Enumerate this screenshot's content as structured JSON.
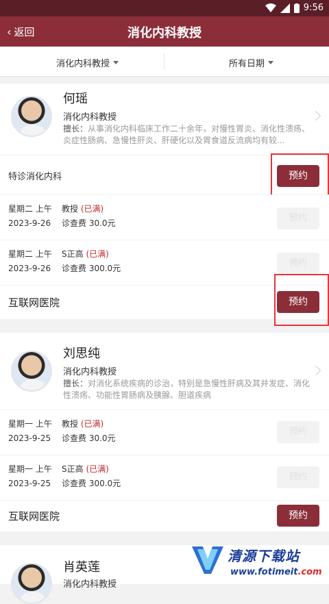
{
  "status_bar": {
    "time": "9:56",
    "icons": [
      "wifi-icon",
      "signal-icon",
      "battery-icon"
    ]
  },
  "header": {
    "back_label": "返回",
    "title": "消化内科教授"
  },
  "filters": {
    "department": "消化内科教授",
    "date": "所有日期"
  },
  "colors": {
    "brand": "#8b2e3a",
    "status_bar": "#5a1e27",
    "full": "#c0282d",
    "highlight_box": "#e8343a"
  },
  "doctors": [
    {
      "name": "何瑶",
      "title": "消化内科教授",
      "skill_label": "擅长：",
      "skill": "从事消化内科临床工作二十余年，对慢性胃炎、消化性溃疡、炎症性肠病、急慢性肝炎、肝硬化以及胃食道反流病均有较...",
      "special_dept": "特诊消化内科",
      "book_label": "预约",
      "schedules": [
        {
          "day": "星期二 上午",
          "date": "2023-9-26",
          "level": "教授",
          "status": "(已满)",
          "fee": "诊查费 30.0元",
          "btn": "预约"
        },
        {
          "day": "星期二 上午",
          "date": "2023-9-26",
          "level": "S正高",
          "status": "(已满)",
          "fee": "诊查费 300.0元",
          "btn": "预约"
        }
      ],
      "hospital": "互联网医院",
      "hospital_btn": "预约"
    },
    {
      "name": "刘思纯",
      "title": "消化内科教授",
      "skill_label": "擅长：",
      "skill": "对消化系统疾病的诊治，特别是急慢性肝病及其并发症、消化性溃疡、功能性胃肠病及胰腺、胆道疾病",
      "schedules": [
        {
          "day": "星期一 上午",
          "date": "2023-9-25",
          "level": "教授",
          "status": "(已满)",
          "fee": "诊查费 30.0元",
          "btn": "预约"
        },
        {
          "day": "星期一 上午",
          "date": "2023-9-25",
          "level": "S正高",
          "status": "(已满)",
          "fee": "诊查费 300.0元",
          "btn": "预约"
        }
      ],
      "hospital": "互联网医院",
      "hospital_btn": "预约"
    },
    {
      "name": "肖英莲",
      "title": "消化内科教授"
    }
  ],
  "watermark": {
    "name": "清源下载站",
    "url_main": "www.fotimeit",
    "url_tail": ".com"
  }
}
